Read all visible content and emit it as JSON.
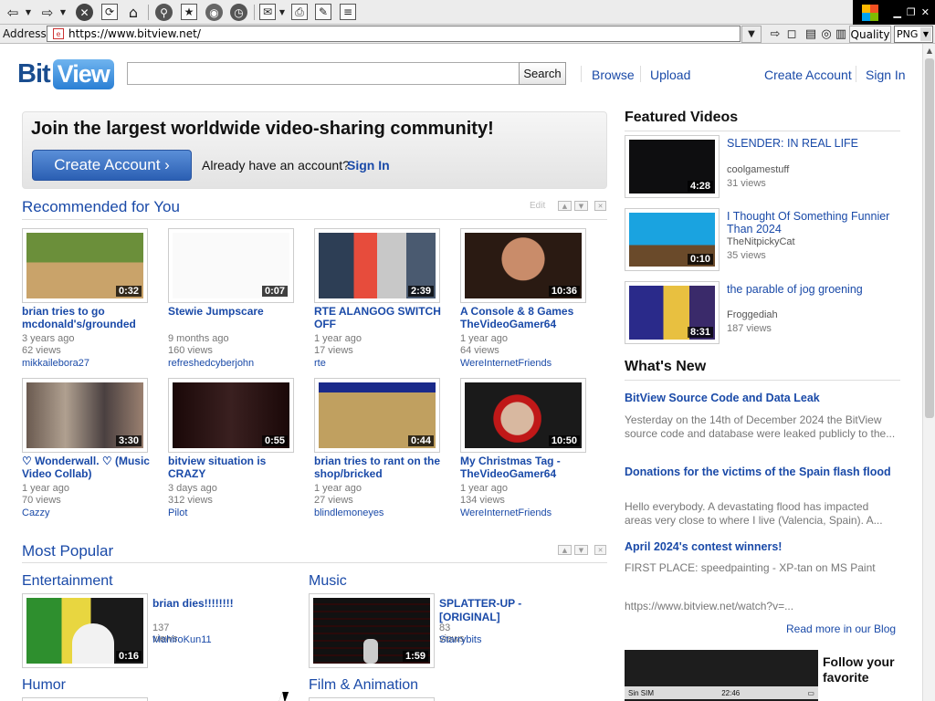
{
  "browser": {
    "address_label": "Address",
    "url": "https://www.bitview.net/",
    "quality_label": "Quality",
    "format_value": "PNG"
  },
  "header": {
    "logo_bit": "Bit",
    "logo_view": "View",
    "search_button": "Search",
    "nav": [
      "Browse",
      "Upload"
    ],
    "account": [
      "Create Account",
      "Sign In"
    ]
  },
  "join": {
    "title": "Join the largest worldwide video-sharing community!",
    "create_button": "Create Account ›",
    "already": "Already have an account?",
    "signin": "Sign In"
  },
  "recommended": {
    "title": "Recommended for You",
    "edit": "Edit",
    "videos": [
      {
        "title": "brian tries to go mcdonald's/grounded",
        "age": "3 years ago",
        "views": "62 views",
        "user": "mikkailebora27",
        "duration": "0:32"
      },
      {
        "title": "Stewie Jumpscare",
        "age": "9 months ago",
        "views": "160 views",
        "user": "refreshedcyberjohn",
        "duration": "0:07"
      },
      {
        "title": "RTE ALANGOG SWITCH OFF",
        "age": "1 year ago",
        "views": "17 views",
        "user": "rte",
        "duration": "2:39"
      },
      {
        "title": "A Console & 8 Games TheVideoGamer64",
        "age": "1 year ago",
        "views": "64 views",
        "user": "WereInternetFriends",
        "duration": "10:36"
      },
      {
        "title": "♡ Wonderwall. ♡ (Music Video Collab)",
        "age": "1 year ago",
        "views": "70 views",
        "user": "Cazzy",
        "duration": "3:30"
      },
      {
        "title": "bitview situation is CRAZY",
        "age": "3 days ago",
        "views": "312 views",
        "user": "Pilot",
        "duration": "0:55"
      },
      {
        "title": "brian tries to rant on the shop/bricked",
        "age": "1 year ago",
        "views": "27 views",
        "user": "blindlemoneyes",
        "duration": "0:44"
      },
      {
        "title": "My Christmas Tag - TheVideoGamer64",
        "age": "1 year ago",
        "views": "134 views",
        "user": "WereInternetFriends",
        "duration": "10:50"
      }
    ]
  },
  "popular": {
    "title": "Most Popular",
    "categories": [
      {
        "name": "Entertainment",
        "video": {
          "title": "brian dies!!!!!!!!",
          "views": "137 views",
          "user": "MahiroKun11",
          "duration": "0:16"
        }
      },
      {
        "name": "Music",
        "video": {
          "title": "SPLATTER-UP - [ORIGINAL]",
          "views": "83 views",
          "user": "Starrybits",
          "duration": "1:59"
        }
      },
      {
        "name": "Humor",
        "video": {
          "title": "",
          "views": "",
          "user": "",
          "duration": ""
        }
      },
      {
        "name": "Film & Animation",
        "video": {
          "title": "",
          "views": "",
          "user": "",
          "duration": ""
        }
      }
    ]
  },
  "featured": {
    "title": "Featured Videos",
    "videos": [
      {
        "title": "SLENDER: IN REAL LIFE",
        "user": "coolgamestuff",
        "views": "31 views",
        "duration": "4:28"
      },
      {
        "title": "I Thought Of Something Funnier Than 2024",
        "user": "TheNitpickyCat",
        "views": "35 views",
        "duration": "0:10"
      },
      {
        "title": "the parable of jog groening",
        "user": "Froggediah",
        "views": "187 views",
        "duration": "8:31"
      }
    ]
  },
  "whats_new": {
    "title": "What's New",
    "items": [
      {
        "title": "BitView Source Code and Data Leak",
        "body": "Yesterday on the 14th of December 2024 the BitView source code and database were leaked publicly to the..."
      },
      {
        "title": "Donations for the victims of the Spain flash flood",
        "body": "Hello everybody. A devastating flood has impacted areas very close to where I live (Valencia, Spain). A..."
      },
      {
        "title": "April 2024's contest winners!",
        "body": "FIRST PLACE: speedpainting - XP-tan on MS Paint",
        "link": "https://www.bitview.net/watch?v=..."
      }
    ],
    "read_more": "Read more in our Blog"
  },
  "ad": {
    "carrier": "Sin SIM",
    "time": "22:46",
    "text": "Follow your favorite"
  }
}
